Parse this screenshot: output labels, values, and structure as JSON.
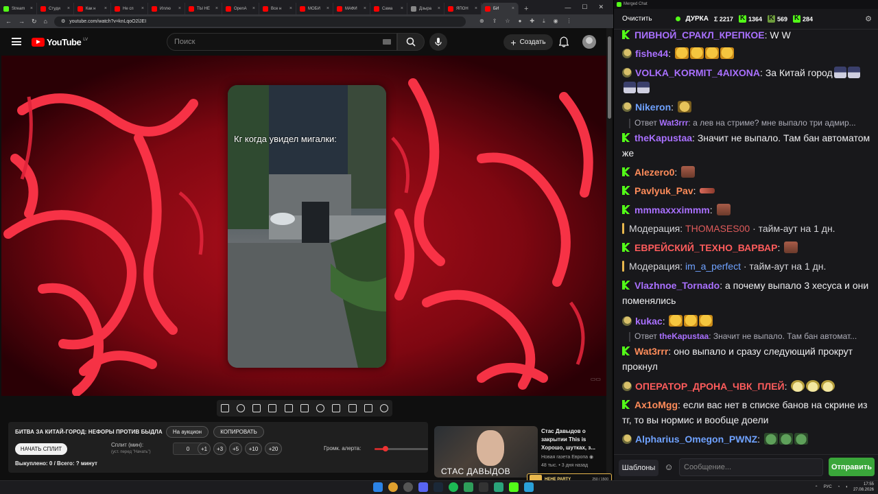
{
  "browser": {
    "tabs": [
      {
        "label": "Stream",
        "type": "tw"
      },
      {
        "label": "Студи",
        "type": "yt"
      },
      {
        "label": "Как н",
        "type": "yt"
      },
      {
        "label": "Не сп",
        "type": "yt"
      },
      {
        "label": "Иллю",
        "type": "yt"
      },
      {
        "label": "ТЫ НЕ",
        "type": "yt"
      },
      {
        "label": "OpenA",
        "type": "yt"
      },
      {
        "label": "Все н",
        "type": "yt"
      },
      {
        "label": "МОБИ",
        "type": "yt"
      },
      {
        "label": "МАФИ",
        "type": "yt"
      },
      {
        "label": "Сама",
        "type": "yt"
      },
      {
        "label": "Дзыра",
        "type": "ot"
      },
      {
        "label": "ЯПОН",
        "type": "yt"
      },
      {
        "label": "БИ",
        "type": "yt",
        "active": true
      }
    ],
    "new_tab": "+",
    "url": "youtube.com/watch?v=knLqoO2lJEI"
  },
  "youtube": {
    "logo": "YouTube",
    "country": "LV",
    "search_placeholder": "Поиск",
    "create_label": "Создать",
    "video_overlay_text": "Кг когда увидел мигалки:"
  },
  "auction": {
    "title": "БИТВА ЗА КИТАЙ-ГОРОД: НЕФОРЫ ПРОТИВ БЫДЛА",
    "auction_btn": "На аукцион",
    "copy_btn": "КОПИРОВАТЬ",
    "start_split_btn": "НАЧАТЬ СПЛИТ",
    "split_label": "Сплит (мин):",
    "split_hint": "(уст. перед \"Начать\")",
    "split_value": "0",
    "step_buttons": [
      "+1",
      "+3",
      "+5",
      "+10",
      "+20"
    ],
    "volume_label": "Громк. алерта:",
    "volume_fraction": 0.2,
    "bought_text": "Выкуплено: 0 / Всего: ? минут"
  },
  "recommendation": {
    "thumb_text": "СТАС ДАВЫДОВ",
    "title": "Стас Давыдов о закрытии This is Хорошо, шутках, з...",
    "channel": "Новая газета Европа",
    "meta": "48 тыс. • 3 дня назад"
  },
  "overlay_badge": {
    "text": "HEHE PARTY",
    "count": "250 / 1500"
  },
  "chat": {
    "window_title": "Merged Chat",
    "clear_label": "Очистить",
    "streamer": "ДУРКА",
    "stat_total": "Σ 2217",
    "stat_kick": "1364",
    "stat_twitch": "569",
    "stat_third": "284",
    "messages": [
      {
        "badge": "k",
        "user": "ПИВНОЙ_СРАКЛ_КРЕПКОЕ",
        "color": "#a970ff",
        "text": "W W"
      },
      {
        "badge": "face",
        "user": "fishe44",
        "color": "#a970ff",
        "text": "",
        "emotes": [
          "laugh",
          "laugh",
          "laugh",
          "laugh"
        ]
      },
      {
        "badge": "face",
        "user": "VOLKA_KORMIT_4AIXONA",
        "color": "#a970ff",
        "text": "За Китай город",
        "emotes": [
          "hat",
          "hat",
          "hat",
          "hat"
        ]
      },
      {
        "badge": "face",
        "user": "Nikeron",
        "color": "#6fa2ff",
        "text": "",
        "emotes": [
          "gold"
        ]
      },
      {
        "type": "reply",
        "reply_prefix": "Ответ",
        "reply_user": "Wat3rrr",
        "reply_text": "а лев на стриме? мне выпало три адмир..."
      },
      {
        "badge": "k",
        "user": "theKapustaa",
        "color": "#a970ff",
        "text": "Значит не выпало. Там бан автоматом же"
      },
      {
        "badge": "k",
        "user": "Alezero0",
        "color": "#ff8c5a",
        "text": "",
        "emotes": [
          "face"
        ]
      },
      {
        "badge": "k",
        "user": "Pavlyuk_Pav",
        "color": "#ff8c5a",
        "text": "",
        "emotes": [
          "line"
        ]
      },
      {
        "badge": "k",
        "user": "mmmaxxximmm",
        "color": "#a970ff",
        "text": "",
        "emotes": [
          "face"
        ]
      },
      {
        "type": "mod",
        "prefix": "Модерация:",
        "target": "THOMASES00",
        "target_color": "red",
        "text": "· тайм-аут на 1 дн."
      },
      {
        "badge": "k",
        "user": "ЕВРЕЙСКИЙ_ТЕХНО_ВАРВАР",
        "color": "#ff5c5c",
        "text": "",
        "emotes": [
          "face"
        ]
      },
      {
        "type": "mod",
        "prefix": "Модерация:",
        "target": "im_a_perfect",
        "target_color": "blue",
        "text": "· тайм-аут на 1 дн."
      },
      {
        "badge": "k",
        "user": "Vlazhnoe_Tornado",
        "color": "#a970ff",
        "text": "а почему выпало 3 хесуса и они поменялись"
      },
      {
        "badge": "face",
        "user": "kukac",
        "color": "#a970ff",
        "text": "",
        "emotes": [
          "laugh",
          "laugh",
          "laugh"
        ]
      },
      {
        "type": "reply",
        "reply_prefix": "Ответ",
        "reply_user": "theKapustaa",
        "reply_text": "Значит не выпало. Там бан автомат..."
      },
      {
        "badge": "k",
        "user": "Wat3rrr",
        "color": "#ff8c5a",
        "text": "оно выпало и сразу следующий прокрут прокнул"
      },
      {
        "badge": "face",
        "user": "ОПЕРАТОР_ДРОНА_ЧВК_ПЛЕЙ",
        "color": "#ff5c5c",
        "text": "",
        "emotes": [
          "sun",
          "sun",
          "sun"
        ]
      },
      {
        "badge": "k",
        "user": "Ax1oMgg",
        "color": "#ff8c5a",
        "text": "если вас нет в списке банов на скрине из тг, то вы нормис и вообще доели"
      },
      {
        "badge": "face",
        "user": "Alpharius_Omegon_PWNZ",
        "color": "#6fa2ff",
        "text": "",
        "emotes": [
          "pepe",
          "pepe",
          "pepe"
        ]
      }
    ],
    "templates_label": "Шаблоны",
    "input_placeholder": "Сообщение...",
    "send_label": "Отправить"
  },
  "taskbar": {
    "lang": "РУС",
    "time": "17:55",
    "date": "27.08.2026"
  }
}
